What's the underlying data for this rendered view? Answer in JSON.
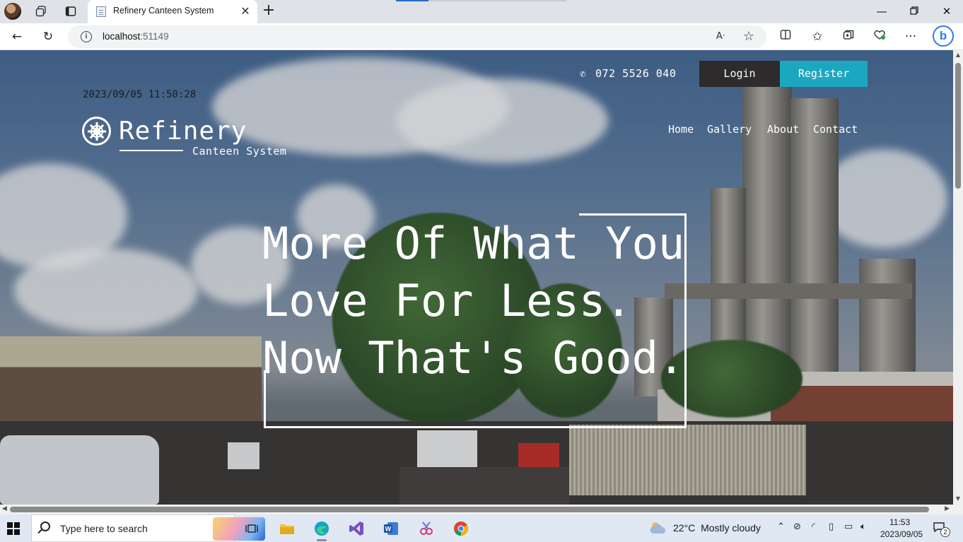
{
  "browser": {
    "tab_title": "Refinery Canteen System",
    "url_host": "localhost",
    "url_port": ":51149"
  },
  "site": {
    "phone": "072 5526 040",
    "login_label": "Login",
    "register_label": "Register",
    "datetime": "2023/09/05 11:50:28",
    "brand": "Refinery",
    "brand_sub": "Canteen System",
    "menu": [
      "Home",
      "Gallery",
      "About",
      "Contact"
    ],
    "headline": [
      "More Of What You",
      "Love For Less.",
      "Now That's Good."
    ],
    "colors": {
      "register": "#1ca7c1",
      "login": "#2d2b2c"
    }
  },
  "taskbar": {
    "search_placeholder": "Type here to search",
    "weather_temp": "22°C",
    "weather_desc": "Mostly cloudy",
    "time": "11:53",
    "date": "2023/09/05",
    "notification_count": "2"
  }
}
